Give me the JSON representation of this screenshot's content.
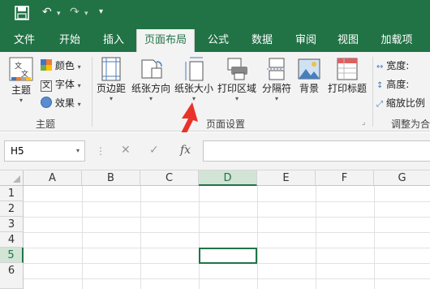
{
  "quick_access": {
    "save_icon": "save-icon",
    "undo_icon": "undo-icon",
    "redo_icon": "redo-icon",
    "customize_glyph": "▾"
  },
  "tabs": [
    "文件",
    "开始",
    "插入",
    "页面布局",
    "公式",
    "数据",
    "审阅",
    "视图",
    "加载项"
  ],
  "active_tab": "页面布局",
  "ribbon": {
    "theme_group": {
      "title": "主题",
      "theme_button": "主题",
      "colors": "颜色",
      "fonts": "字体",
      "effects": "效果"
    },
    "page_setup_group": {
      "title": "页面设置",
      "margins": "页边距",
      "orientation": "纸张方向",
      "size": "纸张大小",
      "print_area": "打印区域",
      "breaks": "分隔符",
      "background": "背景",
      "print_titles": "打印标题"
    },
    "scale_group": {
      "title": "调整为合",
      "width": "宽度:",
      "height": "高度:",
      "scale": "缩放比例"
    }
  },
  "formula_bar": {
    "name_box": "H5",
    "cancel": "✕",
    "enter": "✓",
    "fx": "fx",
    "value": ""
  },
  "grid": {
    "columns": [
      "A",
      "B",
      "C",
      "D",
      "E",
      "F",
      "G"
    ],
    "rows": [
      "1",
      "2",
      "3",
      "4",
      "5",
      "6"
    ],
    "selected_column": "D",
    "selected_row": "5"
  },
  "colors": {
    "brand": "#217346",
    "annotation_arrow": "#e8332a"
  }
}
